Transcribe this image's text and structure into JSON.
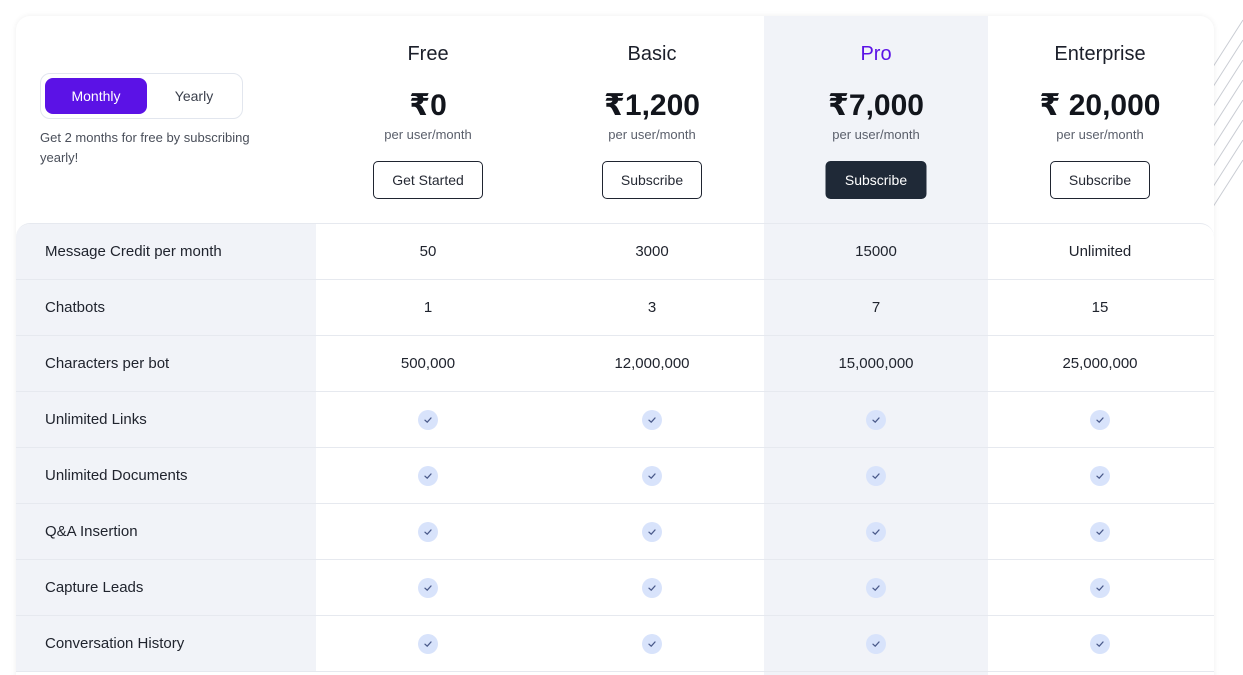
{
  "billing_toggle": {
    "monthly": "Monthly",
    "yearly": "Yearly",
    "selected": "Monthly"
  },
  "promo_text": "Get 2 months for free by subscribing yearly!",
  "plans": [
    {
      "name": "Free",
      "price": "₹0",
      "period": "per user/month",
      "button": "Get Started"
    },
    {
      "name": "Basic",
      "price": "₹1,200",
      "period": "per user/month",
      "button": "Subscribe"
    },
    {
      "name": "Pro",
      "price": "₹7,000",
      "period": "per user/month",
      "button": "Subscribe"
    },
    {
      "name": "Enterprise",
      "price": "₹ 20,000",
      "period": "per user/month",
      "button": "Subscribe"
    }
  ],
  "features": [
    {
      "label": "Message Credit per month",
      "values": [
        "50",
        "3000",
        "15000",
        "Unlimited"
      ]
    },
    {
      "label": "Chatbots",
      "values": [
        "1",
        "3",
        "7",
        "15"
      ]
    },
    {
      "label": "Characters per bot",
      "values": [
        "500,000",
        "12,000,000",
        "15,000,000",
        "25,000,000"
      ]
    },
    {
      "label": "Unlimited Links",
      "included": [
        true,
        true,
        true,
        true
      ]
    },
    {
      "label": "Unlimited Documents",
      "included": [
        true,
        true,
        true,
        true
      ]
    },
    {
      "label": "Q&A Insertion",
      "included": [
        true,
        true,
        true,
        true
      ]
    },
    {
      "label": "Capture Leads",
      "included": [
        true,
        true,
        true,
        true
      ]
    },
    {
      "label": "Conversation History",
      "included": [
        true,
        true,
        true,
        true
      ]
    }
  ],
  "colors": {
    "accent": "#5b12e6",
    "dark_button": "#1f2937",
    "highlight_bg": "#f1f3f8",
    "check_bg": "#d8e3fb",
    "check_mark": "#4a5a8a"
  },
  "icons": {
    "feature_check": "check-circle-icon"
  }
}
